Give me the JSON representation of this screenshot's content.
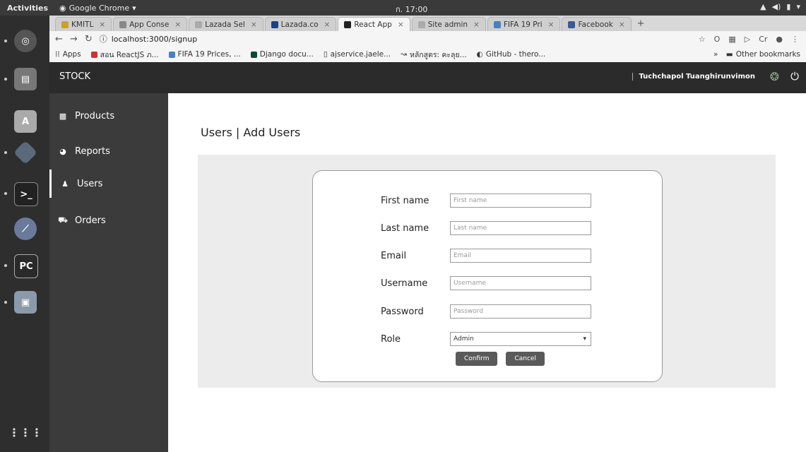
{
  "os": {
    "activities": "Activities",
    "app_name": "Google Chrome",
    "clock": "ก. 17:00"
  },
  "browser": {
    "tabs": [
      {
        "title": "KMITL",
        "color": "#c9a227",
        "active": false
      },
      {
        "title": "App Conse",
        "color": "#888888",
        "active": false
      },
      {
        "title": "Lazada Sel",
        "color": "#aaaaaa",
        "active": false
      },
      {
        "title": "Lazada.co",
        "color": "#1a3f8f",
        "active": false
      },
      {
        "title": "React App",
        "color": "#222222",
        "active": true
      },
      {
        "title": "Site admin",
        "color": "#aaaaaa",
        "active": false
      },
      {
        "title": "FIFA 19 Pri",
        "color": "#4a7fc1",
        "active": false
      },
      {
        "title": "Facebook",
        "color": "#3b5998",
        "active": false
      }
    ],
    "url": "localhost:3000/signup",
    "bookmarks": [
      {
        "label": "Apps",
        "color": "#777777"
      },
      {
        "label": "สอน ReactJS ภ...",
        "color": "#cc3333"
      },
      {
        "label": "FIFA 19 Prices, ...",
        "color": "#4a7fc1"
      },
      {
        "label": "Django docu...",
        "color": "#0c4b33"
      },
      {
        "label": "ajservice.jaele...",
        "color": "#aaaaaa"
      },
      {
        "label": "หลักสูตร: คะลุย...",
        "color": "#888888"
      },
      {
        "label": "GitHub - thero...",
        "color": "#222222"
      }
    ],
    "other_bookmarks": "Other bookmarks"
  },
  "app": {
    "brand": "STOCK",
    "user_name": "Tuchchapol Tuanghirunvimon",
    "menu": [
      {
        "label": "Products",
        "icon": "cubes-icon",
        "active": false
      },
      {
        "label": "Reports",
        "icon": "chart-icon",
        "active": false
      },
      {
        "label": "Users",
        "icon": "user-icon",
        "active": true
      },
      {
        "label": "Orders",
        "icon": "cart-icon",
        "active": false
      }
    ],
    "page_title": "Users | Add Users",
    "form": {
      "first_name": {
        "label": "First name",
        "placeholder": "First name"
      },
      "last_name": {
        "label": "Last name",
        "placeholder": "Last name"
      },
      "email": {
        "label": "Email",
        "placeholder": "Email"
      },
      "username": {
        "label": "Username",
        "placeholder": "Username"
      },
      "password": {
        "label": "Password",
        "placeholder": "Password"
      },
      "role": {
        "label": "Role",
        "value": "Admin"
      },
      "confirm": "Confirm",
      "cancel": "Cancel"
    }
  }
}
